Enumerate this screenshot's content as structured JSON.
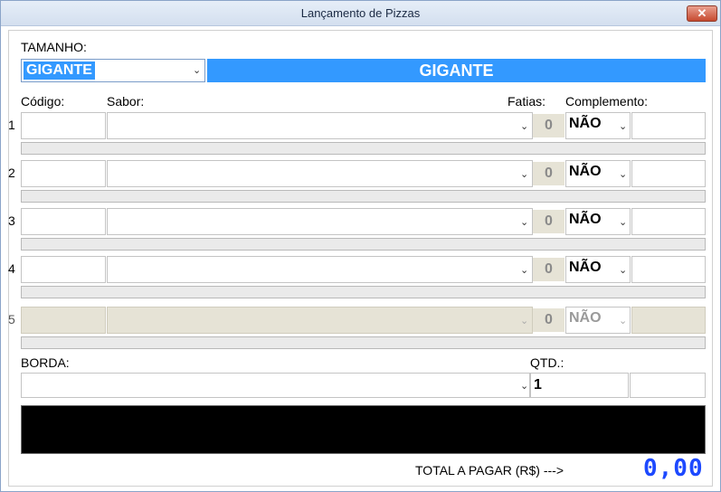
{
  "window": {
    "title": "Lançamento de Pizzas",
    "close_label": "✕"
  },
  "size": {
    "label": "TAMANHO:",
    "selected": "GIGANTE",
    "banner": "GIGANTE"
  },
  "columns": {
    "code": "Código:",
    "flavor": "Sabor:",
    "slices": "Fatias:",
    "complement": "Complemento:"
  },
  "rows": [
    {
      "number": "1",
      "code": "",
      "flavor": "",
      "slices": "0",
      "complement": "NÃO",
      "enabled": true
    },
    {
      "number": "2",
      "code": "",
      "flavor": "",
      "slices": "0",
      "complement": "NÃO",
      "enabled": true
    },
    {
      "number": "3",
      "code": "",
      "flavor": "",
      "slices": "0",
      "complement": "NÃO",
      "enabled": true
    },
    {
      "number": "4",
      "code": "",
      "flavor": "",
      "slices": "0",
      "complement": "NÃO",
      "enabled": true
    },
    {
      "number": "5",
      "code": "",
      "flavor": "",
      "slices": "0",
      "complement": "NÃO",
      "enabled": false
    }
  ],
  "border": {
    "label": "BORDA:",
    "value": ""
  },
  "quantity": {
    "label": "QTD.:",
    "value": "1"
  },
  "total": {
    "label": "TOTAL A PAGAR (R$) --->",
    "value": "0,00"
  },
  "colors": {
    "accent": "#3399ff",
    "total": "#1d49ff",
    "disabled": "#e6e3d6"
  }
}
